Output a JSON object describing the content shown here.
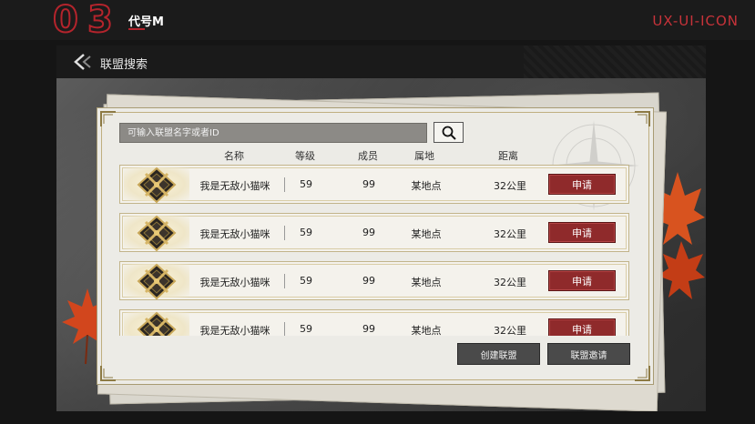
{
  "presentation": {
    "digit_a": "0",
    "digit_b": "3",
    "code_label": "代号M",
    "brand": "UX-UI-ICON",
    "accent_color": "#b4242c"
  },
  "header": {
    "back_icon": "chevron-left-double-icon",
    "title": "联盟搜索"
  },
  "search": {
    "placeholder": "可输入联盟名字或者ID",
    "button_icon": "search-icon"
  },
  "columns": {
    "name": "名称",
    "level": "等级",
    "members": "成员",
    "region": "属地",
    "distance": "距离"
  },
  "alliances": [
    {
      "emblem": "crossed-swords-shield-icon",
      "name": "我是无敌小猫咪",
      "level": "59",
      "members": "99",
      "region": "某地点",
      "distance": "32公里",
      "action": "申请"
    },
    {
      "emblem": "crossed-swords-shield-icon",
      "name": "我是无敌小猫咪",
      "level": "59",
      "members": "99",
      "region": "某地点",
      "distance": "32公里",
      "action": "申请"
    },
    {
      "emblem": "crossed-swords-shield-icon",
      "name": "我是无敌小猫咪",
      "level": "59",
      "members": "99",
      "region": "某地点",
      "distance": "32公里",
      "action": "申请"
    },
    {
      "emblem": "crossed-swords-shield-icon",
      "name": "我是无敌小猫咪",
      "level": "59",
      "members": "99",
      "region": "某地点",
      "distance": "32公里",
      "action": "申请"
    }
  ],
  "actions": {
    "create": "创建联盟",
    "invite": "联盟邀请"
  },
  "colors": {
    "apply_button": "#8f2a2b",
    "action_button": "#4a4a4a",
    "panel": "#ecebe6",
    "gold_trim": "#a89b73"
  }
}
